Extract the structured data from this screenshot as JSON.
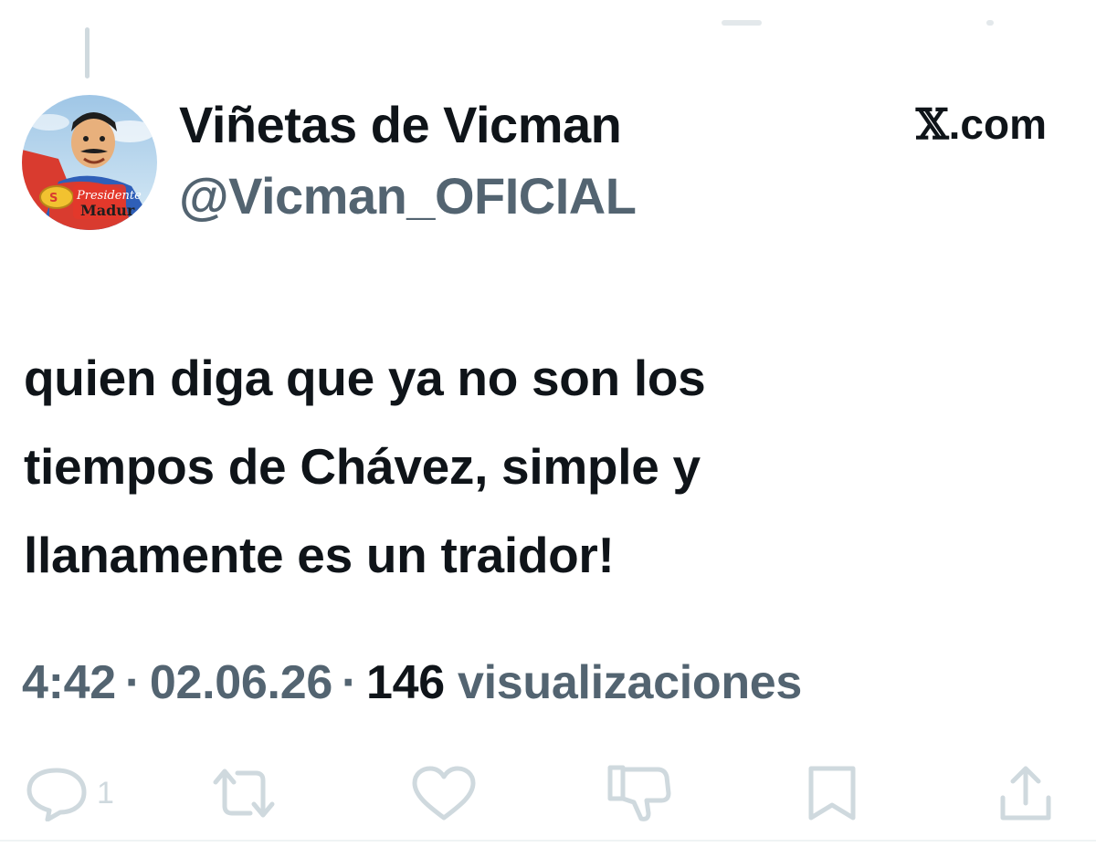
{
  "tweet": {
    "display_name": "Viñetas de Vicman",
    "handle": "@Vicman_OFICIAL",
    "brand_x": "𝕏",
    "brand_domain": ".com",
    "text_lines": [
      "quien diga que ya no son los",
      "tiempos de Chávez, simple y",
      "llanamente es un traidor!"
    ],
    "time": "4:42",
    "separator": "·",
    "date": "02.06.26",
    "views_count": "146",
    "views_label": "visualizaciones"
  },
  "avatar": {
    "badge_line1": "Presidente",
    "badge_line2": "Madur"
  },
  "actions": {
    "reply_count": "1"
  },
  "colors": {
    "text": "#0f1419",
    "secondary": "#536471",
    "icon_faded": "#cfd9de"
  },
  "icons": [
    "reply-icon",
    "retweet-icon",
    "like-icon",
    "dislike-icon",
    "bookmark-icon",
    "share-icon"
  ]
}
